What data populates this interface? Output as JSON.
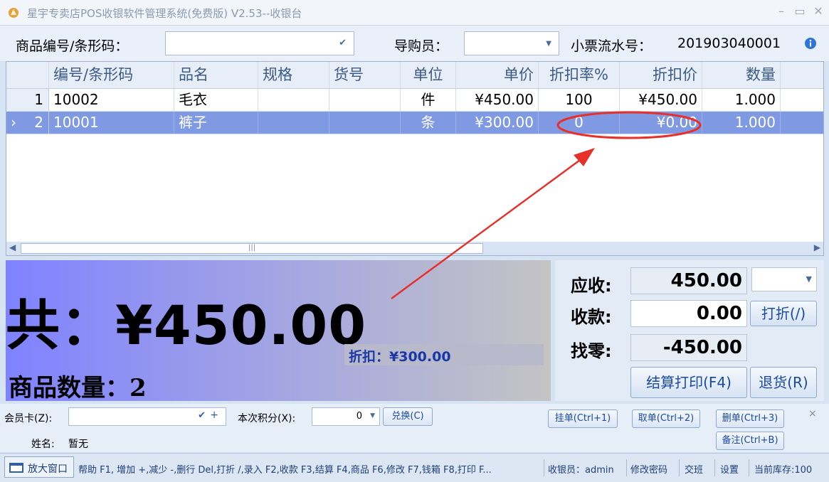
{
  "window": {
    "title": "星宇专卖店POS收银软件管理系统(免费版) V2.53--收银台",
    "min_glyph": "–",
    "max_glyph": "▭",
    "close_glyph": "✕"
  },
  "query": {
    "code_label": "商品编号/条形码：",
    "code_value": "",
    "guide_label": "导购员：",
    "guide_value": "",
    "receipt_label": "小票流水号：",
    "receipt_no": "201903040001"
  },
  "grid": {
    "columns": [
      "编号/条形码",
      "品名",
      "规格",
      "货号",
      "单位",
      "单价",
      "折扣率%",
      "折扣价",
      "数量"
    ],
    "rows": [
      {
        "indicator": "",
        "no": "1",
        "code": "10002",
        "name": "毛衣",
        "spec": "",
        "item_no": "",
        "unit": "件",
        "price": "¥450.00",
        "rate": "100",
        "disc_price": "¥450.00",
        "qty": "1.000"
      },
      {
        "indicator": "›",
        "no": "2",
        "code": "10001",
        "name": "裤子",
        "spec": "",
        "item_no": "",
        "unit": "条",
        "price": "¥300.00",
        "rate": "0",
        "disc_price": "¥0.00",
        "qty": "1.000"
      }
    ],
    "selected_row": 1
  },
  "summary": {
    "total_text": "共：¥450.00",
    "discount_text": "折扣：¥300.00",
    "count_label": "商品数量：",
    "count_value": "2"
  },
  "payment": {
    "receivable_label": "应收:",
    "receivable": "450.00",
    "received_label": "收款:",
    "received": "0.00",
    "change_label": "找零:",
    "change": "-450.00",
    "discount_btn": "打折(/)",
    "checkout_btn": "结算打印(F4)",
    "return_btn": "退货(R)"
  },
  "member": {
    "card_label": "会员卡(Z):",
    "card_value": "",
    "points_label": "本次积分(X):",
    "points_value": "0",
    "redeem_btn": "兑换(C)",
    "name_label": "姓名:",
    "name_value": "暂无",
    "hold_btn": "挂单(Ctrl+1)",
    "retrieve_btn": "取单(Ctrl+2)",
    "delete_btn": "删单(Ctrl+3)",
    "note_btn": "备注(Ctrl+B)",
    "close_glyph": "×"
  },
  "status": {
    "expand_btn": "放大窗口",
    "help_text": "帮助 F1, 增加 +,减少 -,删行 Del,打折 /,录入 F2,收款 F3,结算 F4,商品 F6,修改 F7,钱箱 F8,打印 F...",
    "cashier": "收银员：admin",
    "change_pwd": "修改密码",
    "shift": "交班",
    "settings": "设置",
    "stock": "当前库存:100"
  },
  "colors": {
    "selected_row": "#7f9ae2",
    "annotation": "#e8302a",
    "discount_text": "#1a38a6"
  },
  "icons": {
    "app": "app-logo-icon",
    "info": "info-icon",
    "dropdown": "chevron-down-icon",
    "window": "window-icon"
  }
}
